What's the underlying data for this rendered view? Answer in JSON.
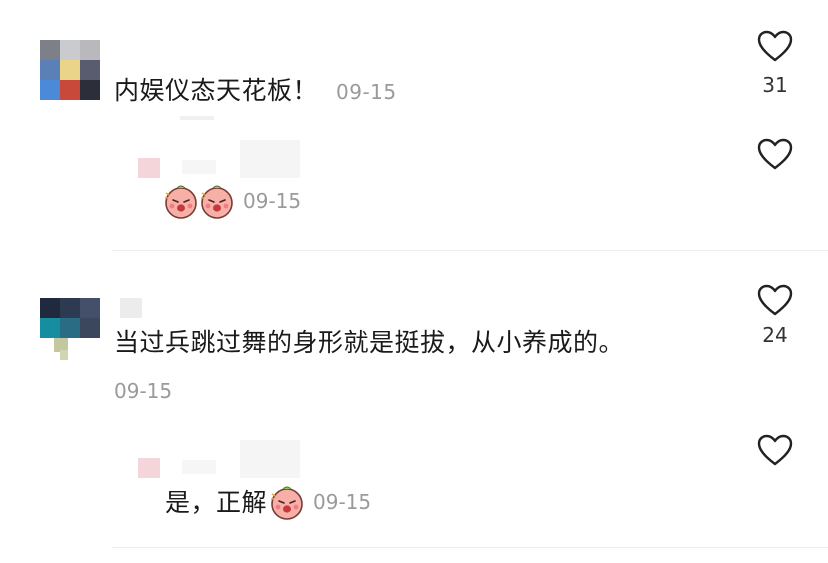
{
  "comments": [
    {
      "text": "内娱仪态天花板！",
      "time": "09-15",
      "likes": "31",
      "reply": {
        "emojis": [
          "shy-face-emoji",
          "shy-face-emoji"
        ],
        "time": "09-15"
      }
    },
    {
      "text": "当过兵跳过舞的身形就是挺拔，从小养成的。",
      "time": "09-15",
      "likes": "24",
      "reply": {
        "text": "是，正解",
        "emojis": [
          "shy-face-emoji"
        ],
        "time": "09-15"
      }
    }
  ],
  "colors": {
    "text": "#1a1a1a",
    "muted": "#9a9a9a",
    "divider": "#ececec"
  }
}
